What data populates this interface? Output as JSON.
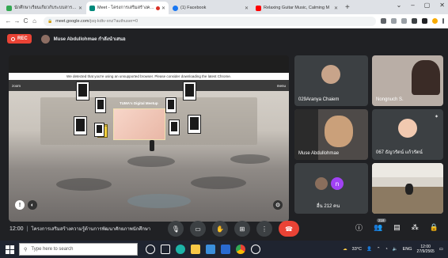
{
  "browser": {
    "tabs": [
      {
        "title": "นักศึกษาเรียนเกี่ยวกับระบบสารสนเทศ",
        "favicon_color": "#34a853",
        "active": false
      },
      {
        "title": "Meet - โครงการเสริมสร้างความรู้...",
        "favicon_color": "#00897b",
        "active": true,
        "recording": true
      },
      {
        "title": "(1) Facebook",
        "favicon_color": "#1877f2",
        "active": false
      },
      {
        "title": "Relaxing Guitar Music, Calming M",
        "favicon_color": "#ff0000",
        "active": false
      }
    ],
    "new_tab_glyph": "+",
    "window_controls": [
      "⌄",
      "–",
      "▢",
      "✕"
    ],
    "nav": {
      "back": "←",
      "forward": "→",
      "reload": "C",
      "home": "⌂"
    },
    "url": {
      "host": "meet.google.com",
      "rest": "/jsq-kdtv-xnz?authuser=0"
    }
  },
  "meet": {
    "rec_label": "REC",
    "presenter_name": "Muse Abdullohmae กำลังนำเสนอ",
    "presentation": {
      "notice": "We detected that you're using an unsupported browser. Please consider downloading the latest Chrome.",
      "scene_title": "TUMA's Digital Meetup",
      "sign_text": "Welcome to TUMA",
      "left_label": "zoom",
      "right_label": "menu",
      "info_glyph": "!",
      "mic_glyph": "◐",
      "right_glyph": "⊙"
    },
    "participants": [
      {
        "name": "029Aranya Chaiem",
        "avatar_color": "#c8a48a"
      },
      {
        "name": "Nongnuch S.",
        "avatar_color": "#d9b09a"
      },
      {
        "name": "Muse Abdullohmae",
        "avatar_color": "#caa07a"
      },
      {
        "name": "067 ธัญวรัตน์ แก้วรัตน์",
        "avatar_color": "#f1c9b0"
      },
      {
        "name": "อื่น 212 คน",
        "avatar_color": "#a142f4",
        "letter": "n"
      },
      {
        "name": "",
        "avatar_color": "#8a7a6a"
      }
    ],
    "bottom": {
      "time": "12:00",
      "separator": "|",
      "meeting_name": "โครงการเสริมสร้างความรู้ด้านการพัฒนาศักยภาพนักศึกษา",
      "people_count": "218"
    }
  },
  "taskbar": {
    "search_placeholder": "Type here to search",
    "weather": "33°C",
    "language": "ENG",
    "clock_time": "12:00",
    "clock_date": "27/9/2565"
  }
}
